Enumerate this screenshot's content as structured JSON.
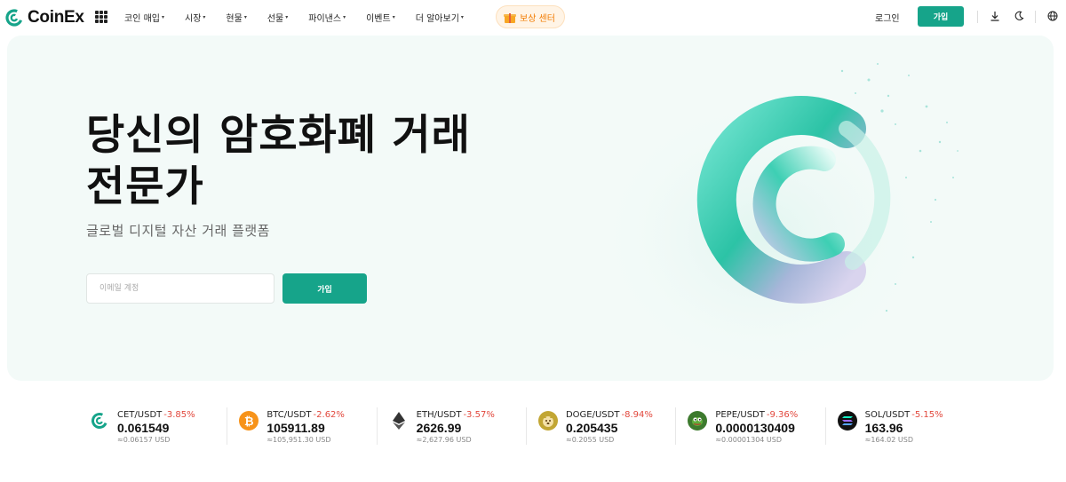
{
  "brand": {
    "name": "CoinEx",
    "accent": "#16a48a"
  },
  "nav": {
    "menu": [
      {
        "label": "코인 매입",
        "has_caret": true
      },
      {
        "label": "시장",
        "has_caret": true
      },
      {
        "label": "현물",
        "has_caret": true
      },
      {
        "label": "선물",
        "has_caret": true
      },
      {
        "label": "파이낸스",
        "has_caret": true
      },
      {
        "label": "이벤트",
        "has_caret": true
      },
      {
        "label": "더 알아보기",
        "has_caret": true
      }
    ],
    "caret": "▾",
    "reward_label": "보상 센터",
    "login_label": "로그인",
    "signup_label": "가입",
    "icons": [
      "apps-grid-icon",
      "gift-icon",
      "download-icon",
      "dark-mode-icon",
      "globe-icon"
    ]
  },
  "hero": {
    "title_line1": "당신의 암호화폐 거래",
    "title_line2": "전문가",
    "subtitle": "글로벌 디지털 자산 거래 플랫폼",
    "email_placeholder": "이메일 계정",
    "signup_label": "가입"
  },
  "tickers": [
    {
      "pair": "CET/USDT",
      "change": "-3.85%",
      "price": "0.061549",
      "usd": "≈0.06157 USD",
      "icon": "cet-icon",
      "color": "#16a48a"
    },
    {
      "pair": "BTC/USDT",
      "change": "-2.62%",
      "price": "105911.89",
      "usd": "≈105,951.30 USD",
      "icon": "btc-icon",
      "color": "#f7931a"
    },
    {
      "pair": "ETH/USDT",
      "change": "-3.57%",
      "price": "2626.99",
      "usd": "≈2,627.96 USD",
      "icon": "eth-icon",
      "color": "#333333"
    },
    {
      "pair": "DOGE/USDT",
      "change": "-8.94%",
      "price": "0.205435",
      "usd": "≈0.2055 USD",
      "icon": "doge-icon",
      "color": "#c2a633"
    },
    {
      "pair": "PEPE/USDT",
      "change": "-9.36%",
      "price": "0.0000130409",
      "usd": "≈0.00001304 USD",
      "icon": "pepe-icon",
      "color": "#3d7a2e"
    },
    {
      "pair": "SOL/USDT",
      "change": "-5.15%",
      "price": "163.96",
      "usd": "≈164.02 USD",
      "icon": "sol-icon",
      "color": "#111111"
    }
  ]
}
